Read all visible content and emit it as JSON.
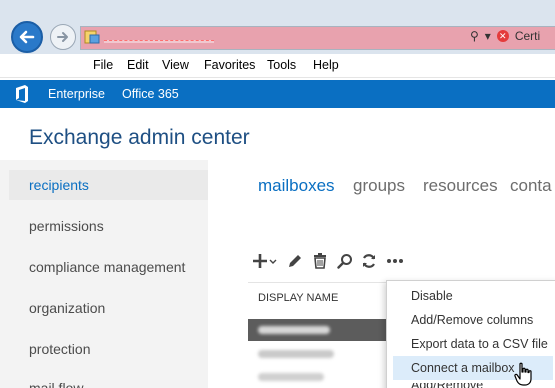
{
  "browser": {
    "address_tools": {
      "dropdown": "▾",
      "cert_label": "Certi"
    }
  },
  "menubar": {
    "items": [
      "File",
      "Edit",
      "View",
      "Favorites",
      "Tools",
      "Help"
    ]
  },
  "ribbon": {
    "enterprise": "Enterprise",
    "office365": "Office 365"
  },
  "app": {
    "title": "Exchange admin center"
  },
  "leftnav": {
    "items": [
      {
        "label": "recipients",
        "active": true
      },
      {
        "label": "permissions"
      },
      {
        "label": "compliance management"
      },
      {
        "label": "organization"
      },
      {
        "label": "protection"
      },
      {
        "label": "mail flow"
      }
    ]
  },
  "tabs": {
    "items": [
      {
        "label": "mailboxes",
        "active": true
      },
      {
        "label": "groups"
      },
      {
        "label": "resources"
      },
      {
        "label": "conta"
      }
    ]
  },
  "toolbar": {
    "icons": [
      "add-icon",
      "edit-icon",
      "delete-icon",
      "search-icon",
      "refresh-icon",
      "more-icon"
    ]
  },
  "table": {
    "column_header": "DISPLAY NAME"
  },
  "context_menu": {
    "items": [
      {
        "label": "Disable"
      },
      {
        "label": "Add/Remove columns"
      },
      {
        "label": "Export data to a CSV file"
      },
      {
        "label": "Connect a mailbox",
        "hovered": true
      },
      {
        "label": "Add/Remove"
      }
    ]
  },
  "colors": {
    "brand_blue": "#0a6fc2",
    "title_blue": "#1e4f83",
    "address_bar": "#e8a2ae"
  }
}
